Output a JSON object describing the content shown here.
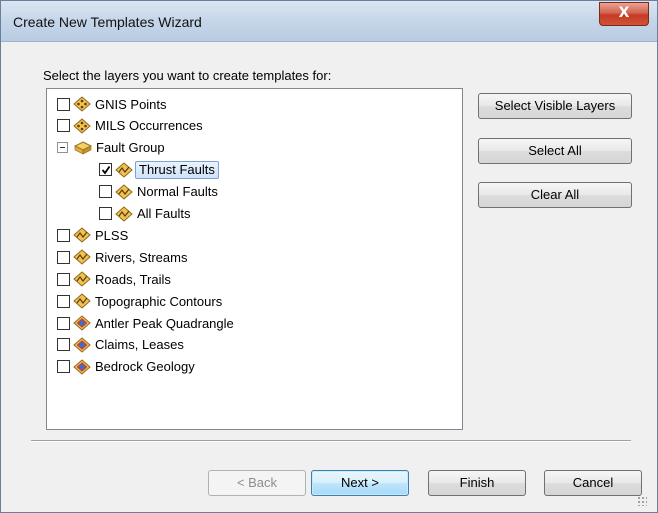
{
  "window": {
    "title": "Create New Templates Wizard",
    "close_label": "X"
  },
  "prompt": "Select the layers you want to create templates for:",
  "tree": {
    "items": [
      {
        "label": "GNIS Points",
        "level": 0,
        "type": "point",
        "checked": false
      },
      {
        "label": "MILS Occurrences",
        "level": 0,
        "type": "point",
        "checked": false
      },
      {
        "label": "Fault Group",
        "level": 0,
        "type": "group",
        "expander": "−"
      },
      {
        "label": "Thrust Faults",
        "level": 1,
        "type": "line",
        "checked": true,
        "selected": true
      },
      {
        "label": "Normal Faults",
        "level": 1,
        "type": "line",
        "checked": false
      },
      {
        "label": "All Faults",
        "level": 1,
        "type": "line",
        "checked": false
      },
      {
        "label": "PLSS",
        "level": 0,
        "type": "line",
        "checked": false
      },
      {
        "label": "Rivers, Streams",
        "level": 0,
        "type": "line",
        "checked": false
      },
      {
        "label": "Roads, Trails",
        "level": 0,
        "type": "line",
        "checked": false
      },
      {
        "label": "Topographic Contours",
        "level": 0,
        "type": "line",
        "checked": false
      },
      {
        "label": "Antler Peak Quadrangle",
        "level": 0,
        "type": "polygon",
        "checked": false
      },
      {
        "label": "Claims, Leases",
        "level": 0,
        "type": "polygon",
        "checked": false
      },
      {
        "label": "Bedrock Geology",
        "level": 0,
        "type": "polygon",
        "checked": false
      }
    ]
  },
  "side_buttons": {
    "select_visible": "Select Visible Layers",
    "select_all": "Select All",
    "clear_all": "Clear All"
  },
  "footer_buttons": {
    "back": "< Back",
    "next": "Next >",
    "finish": "Finish",
    "cancel": "Cancel"
  },
  "colors": {
    "icon_fill": "#f2c14e",
    "icon_stroke": "#8a6a1e",
    "polygon_accent": "#d23c2a",
    "polygon_inner": "#3a6fd1",
    "selection_border": "#7da2ce"
  }
}
